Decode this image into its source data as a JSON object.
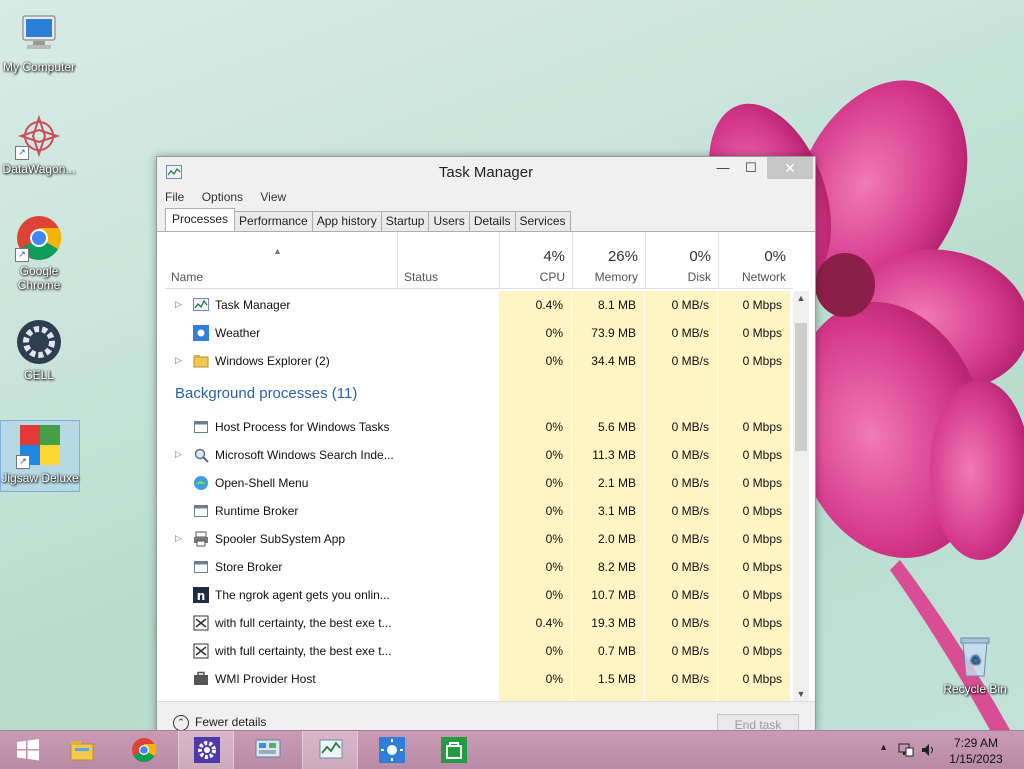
{
  "desktop": {
    "icons": [
      {
        "label": "My Computer",
        "icon": "computer-icon"
      },
      {
        "label": "DataWagon...",
        "icon": "datawagon-icon"
      },
      {
        "label": "Google Chrome",
        "icon": "chrome-icon"
      },
      {
        "label": "CELL",
        "icon": "gear-icon"
      },
      {
        "label": "Jigsaw Deluxe",
        "icon": "puzzle-icon"
      },
      {
        "label": "Recycle Bin",
        "icon": "recycle-bin-icon"
      }
    ]
  },
  "window": {
    "title": "Task Manager",
    "controls": {
      "minimize": "—",
      "maximize": "☐",
      "close": "✕"
    },
    "menu": [
      "File",
      "Options",
      "View"
    ],
    "tabs": [
      "Processes",
      "Performance",
      "App history",
      "Startup",
      "Users",
      "Details",
      "Services"
    ],
    "active_tab": "Processes",
    "columns": {
      "name": "Name",
      "status": "Status",
      "cpu": {
        "label": "CPU",
        "pct": "4%"
      },
      "memory": {
        "label": "Memory",
        "pct": "26%"
      },
      "disk": {
        "label": "Disk",
        "pct": "0%"
      },
      "network": {
        "label": "Network",
        "pct": "0%"
      }
    },
    "apps": [
      {
        "name": "Task Manager",
        "expand": true,
        "icon": "task-manager-icon",
        "cpu": "0.4%",
        "memory": "8.1 MB",
        "disk": "0 MB/s",
        "network": "0 Mbps"
      },
      {
        "name": "Weather",
        "expand": false,
        "icon": "weather-icon",
        "cpu": "0%",
        "memory": "73.9 MB",
        "disk": "0 MB/s",
        "network": "0 Mbps"
      },
      {
        "name": "Windows Explorer (2)",
        "expand": true,
        "icon": "folder-icon",
        "cpu": "0%",
        "memory": "34.4 MB",
        "disk": "0 MB/s",
        "network": "0 Mbps"
      }
    ],
    "background_title": "Background processes (11)",
    "background": [
      {
        "name": "Host Process for Windows Tasks",
        "expand": false,
        "icon": "process-icon",
        "cpu": "0%",
        "memory": "5.6 MB",
        "disk": "0 MB/s",
        "network": "0 Mbps"
      },
      {
        "name": "Microsoft Windows Search Inde...",
        "expand": true,
        "icon": "search-index-icon",
        "cpu": "0%",
        "memory": "11.3 MB",
        "disk": "0 MB/s",
        "network": "0 Mbps"
      },
      {
        "name": "Open-Shell Menu",
        "expand": false,
        "icon": "shell-icon",
        "cpu": "0%",
        "memory": "2.1 MB",
        "disk": "0 MB/s",
        "network": "0 Mbps"
      },
      {
        "name": "Runtime Broker",
        "expand": false,
        "icon": "process-icon",
        "cpu": "0%",
        "memory": "3.1 MB",
        "disk": "0 MB/s",
        "network": "0 Mbps"
      },
      {
        "name": "Spooler SubSystem App",
        "expand": true,
        "icon": "printer-icon",
        "cpu": "0%",
        "memory": "2.0 MB",
        "disk": "0 MB/s",
        "network": "0 Mbps"
      },
      {
        "name": "Store Broker",
        "expand": false,
        "icon": "process-icon",
        "cpu": "0%",
        "memory": "8.2 MB",
        "disk": "0 MB/s",
        "network": "0 Mbps"
      },
      {
        "name": "The ngrok agent gets you onlin...",
        "expand": false,
        "icon": "ngrok-icon",
        "cpu": "0%",
        "memory": "10.7 MB",
        "disk": "0 MB/s",
        "network": "0 Mbps"
      },
      {
        "name": "with full certainty, the best exe t...",
        "expand": false,
        "icon": "exe-icon",
        "cpu": "0.4%",
        "memory": "19.3 MB",
        "disk": "0 MB/s",
        "network": "0 Mbps"
      },
      {
        "name": "with full certainty, the best exe t...",
        "expand": false,
        "icon": "exe-icon",
        "cpu": "0%",
        "memory": "0.7 MB",
        "disk": "0 MB/s",
        "network": "0 Mbps"
      },
      {
        "name": "WMI Provider Host",
        "expand": false,
        "icon": "wmi-icon",
        "cpu": "0%",
        "memory": "1.5 MB",
        "disk": "0 MB/s",
        "network": "0 Mbps"
      }
    ],
    "footer": {
      "fewer_details": "Fewer details",
      "end_task": "End task"
    }
  },
  "taskbar": {
    "apps": [
      "start-icon",
      "file-explorer-icon",
      "chrome-icon",
      "settings-gear-icon",
      "control-panel-icon",
      "task-manager-icon",
      "weather-icon",
      "store-icon"
    ],
    "time": "7:29 AM",
    "date": "1/15/2023"
  },
  "colors": {
    "accent_blue": "#2a62a8",
    "heat_yellow": "#fff4c4",
    "taskbar": "#c99bb6"
  }
}
